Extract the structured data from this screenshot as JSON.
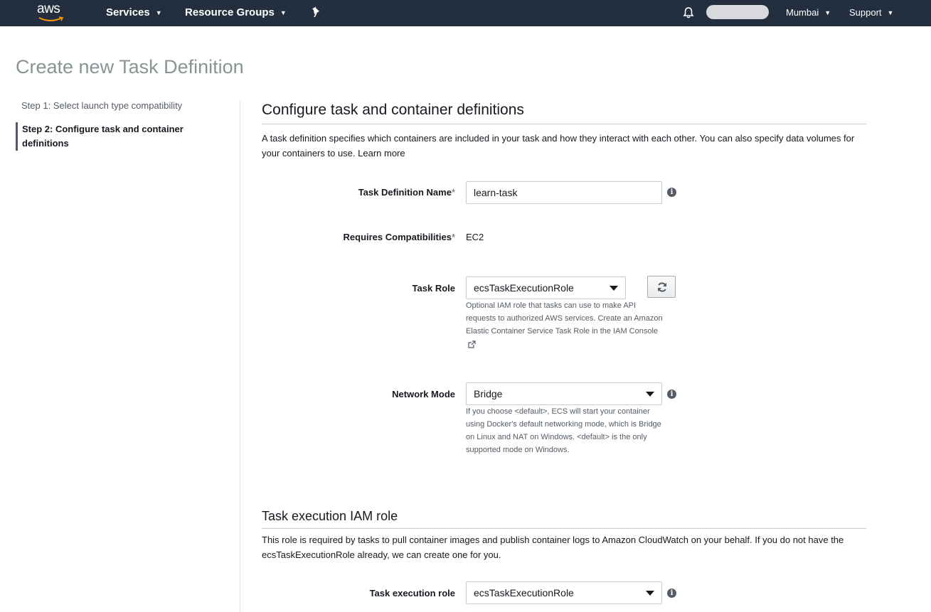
{
  "nav": {
    "logo": "aws",
    "services": "Services",
    "resource_groups": "Resource Groups",
    "region": "Mumbai",
    "support": "Support",
    "icons": {
      "pin": "pin-icon",
      "bell": "bell-icon",
      "caret": "chevron-down-icon"
    }
  },
  "page": {
    "title": "Create new Task Definition"
  },
  "steps": [
    {
      "label": "Step 1: Select launch type compatibility",
      "active": false
    },
    {
      "label": "Step 2: Configure task and container definitions",
      "active": true
    }
  ],
  "configure": {
    "title": "Configure task and container definitions",
    "description": "A task definition specifies which containers are included in your task and how they interact with each other. You can also specify data volumes for your containers to use. Learn more",
    "task_definition_name": {
      "label": "Task Definition Name",
      "required": "*",
      "value": "learn-task"
    },
    "requires_compatibilities": {
      "label": "Requires Compatibilities",
      "required": "*",
      "value": "EC2"
    },
    "task_role": {
      "label": "Task Role",
      "value": "ecsTaskExecutionRole",
      "help": "Optional IAM role that tasks can use to make API requests to authorized AWS services. Create an Amazon Elastic Container Service Task Role in the IAM Console"
    },
    "network_mode": {
      "label": "Network Mode",
      "value": "Bridge",
      "help": "If you choose <default>, ECS will start your container using Docker's default networking mode, which is Bridge on Linux and NAT on Windows. <default> is the only supported mode on Windows."
    }
  },
  "execution_role": {
    "title": "Task execution IAM role",
    "description": "This role is required by tasks to pull container images and publish container logs to Amazon CloudWatch on your behalf. If you do not have the ecsTaskExecutionRole already, we can create one for you.",
    "label": "Task execution role",
    "value": "ecsTaskExecutionRole"
  },
  "colors": {
    "nav_bg": "#232f3e",
    "title_gray": "#879596",
    "text": "#16191f"
  }
}
